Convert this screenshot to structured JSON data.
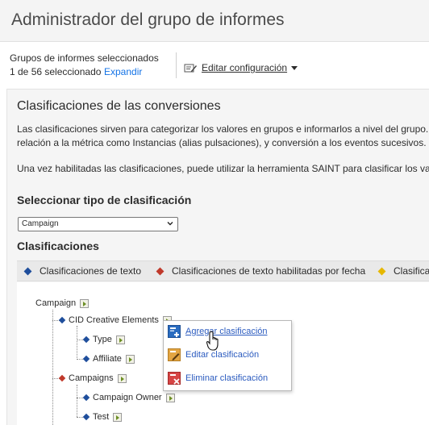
{
  "header": {
    "title": "Administrador del grupo de informes"
  },
  "selection": {
    "label": "Grupos de informes seleccionados",
    "count": "1 de 56 seleccionado",
    "expand": "Expandir"
  },
  "config": {
    "label": "Editar configuración",
    "icon": "edit-settings-icon"
  },
  "section": {
    "title": "Clasificaciones de las conversiones",
    "desc_line1": "Las clasificaciones sirven para categorizar los valores en grupos e informarlos a nivel del grupo. Po",
    "desc_line2": "relación a la métrica como Instancias (alias pulsaciones), y conversión a los eventos sucesivos.",
    "desc_line3": "Una vez habilitadas las clasificaciones, puede utilizar la herramienta SAINT para clasificar los valor"
  },
  "type_select": {
    "heading": "Seleccionar tipo de clasificación",
    "value": "Campaign"
  },
  "classifications": {
    "heading": "Clasificaciones",
    "legend": [
      {
        "label": "Clasificaciones de texto",
        "color": "#1f4e9c"
      },
      {
        "label": "Clasificaciones de texto habilitadas por fecha",
        "color": "#c0392b"
      },
      {
        "label": "Clasifica",
        "color": "#e6b800"
      }
    ]
  },
  "tree": {
    "root": "Campaign",
    "nodes": [
      {
        "label": "CID Creative Elements",
        "color": "#1f4e9c"
      },
      {
        "label": "Type",
        "color": "#1f4e9c"
      },
      {
        "label": "Affiliate",
        "color": "#1f4e9c"
      },
      {
        "label": "Campaigns",
        "color": "#c0392b"
      },
      {
        "label": "Campaign Owner",
        "color": "#1f4e9c"
      },
      {
        "label": "Test",
        "color": "#1f4e9c"
      }
    ]
  },
  "context_menu": {
    "items": [
      {
        "label": "Agregar clasificación",
        "icon": "add-classification-icon"
      },
      {
        "label": "Editar clasificación",
        "icon": "edit-classification-icon"
      },
      {
        "label": "Eliminar clasificación",
        "icon": "delete-classification-icon"
      }
    ]
  }
}
